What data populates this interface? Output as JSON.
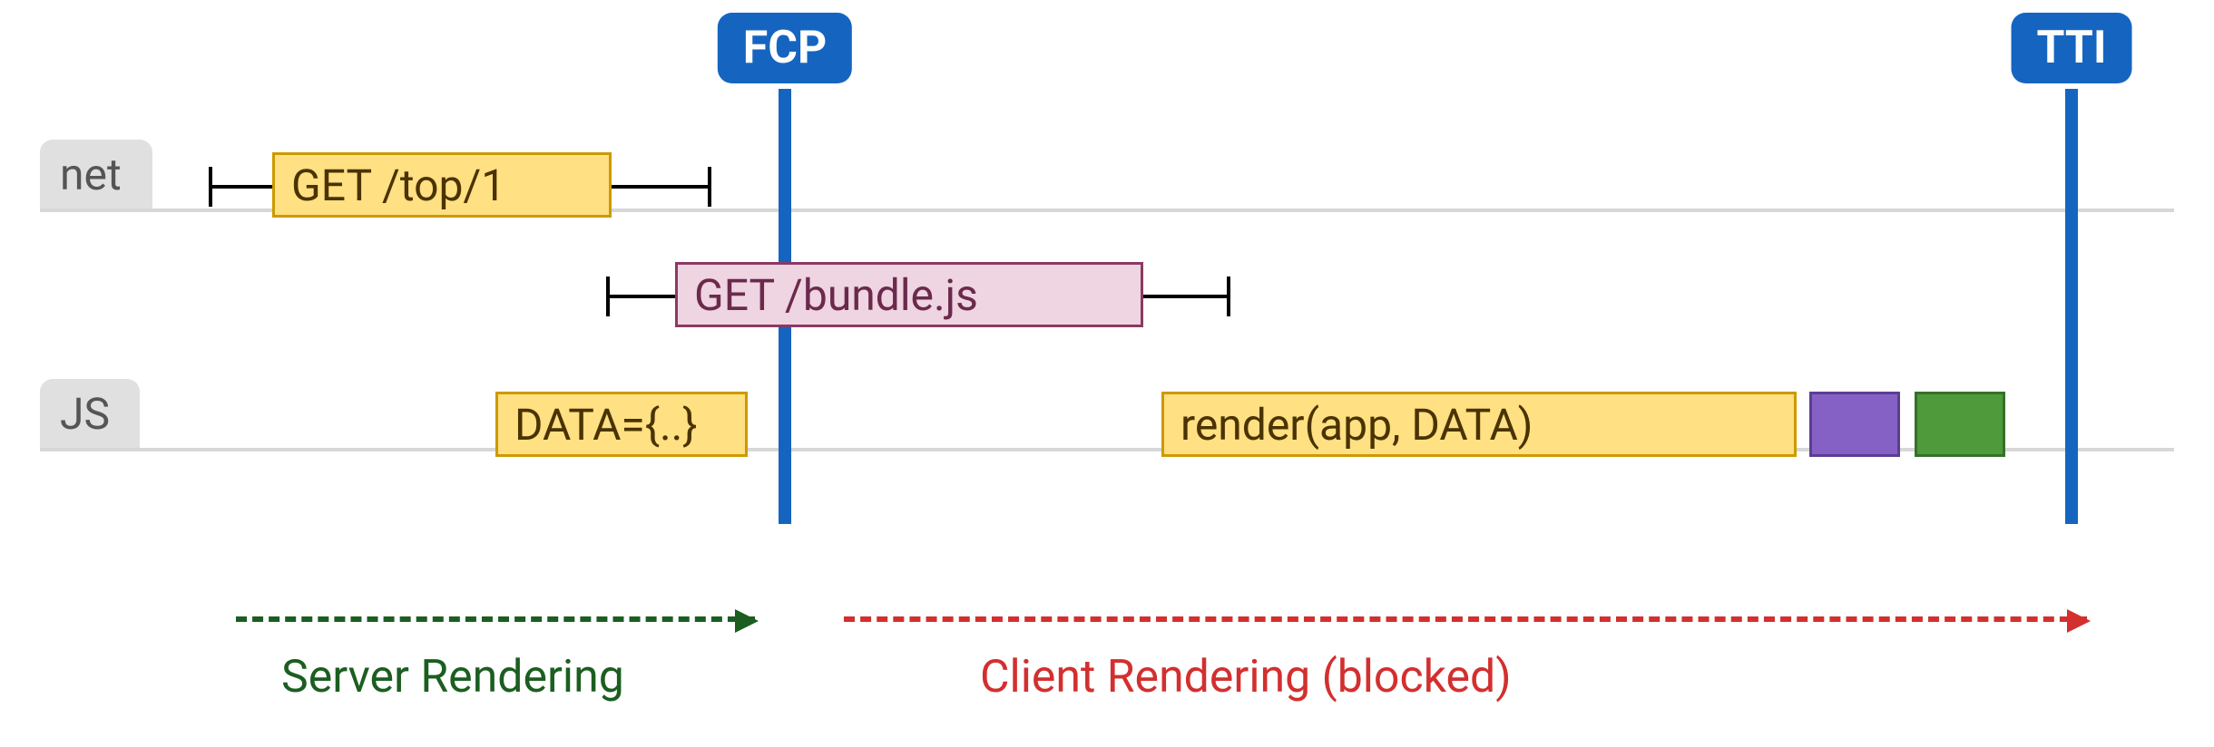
{
  "tracks": {
    "net": "net",
    "js": "JS"
  },
  "markers": {
    "fcp": "FCP",
    "tti": "TTI"
  },
  "net": {
    "get_top": "GET /top/1",
    "get_bundle": "GET /bundle.js"
  },
  "js": {
    "data": "DATA={..}",
    "render": "render(app, DATA)"
  },
  "phases": {
    "server": "Server Rendering",
    "client": "Client Rendering (blocked)"
  },
  "colors": {
    "marker": "#1565c0",
    "yellow_fill": "#ffe082",
    "pink_fill": "#efd4e2",
    "purple_fill": "#8561c5",
    "green_fill": "#4f9a3a",
    "server": "#1b5e20",
    "client": "#d32f2f"
  }
}
